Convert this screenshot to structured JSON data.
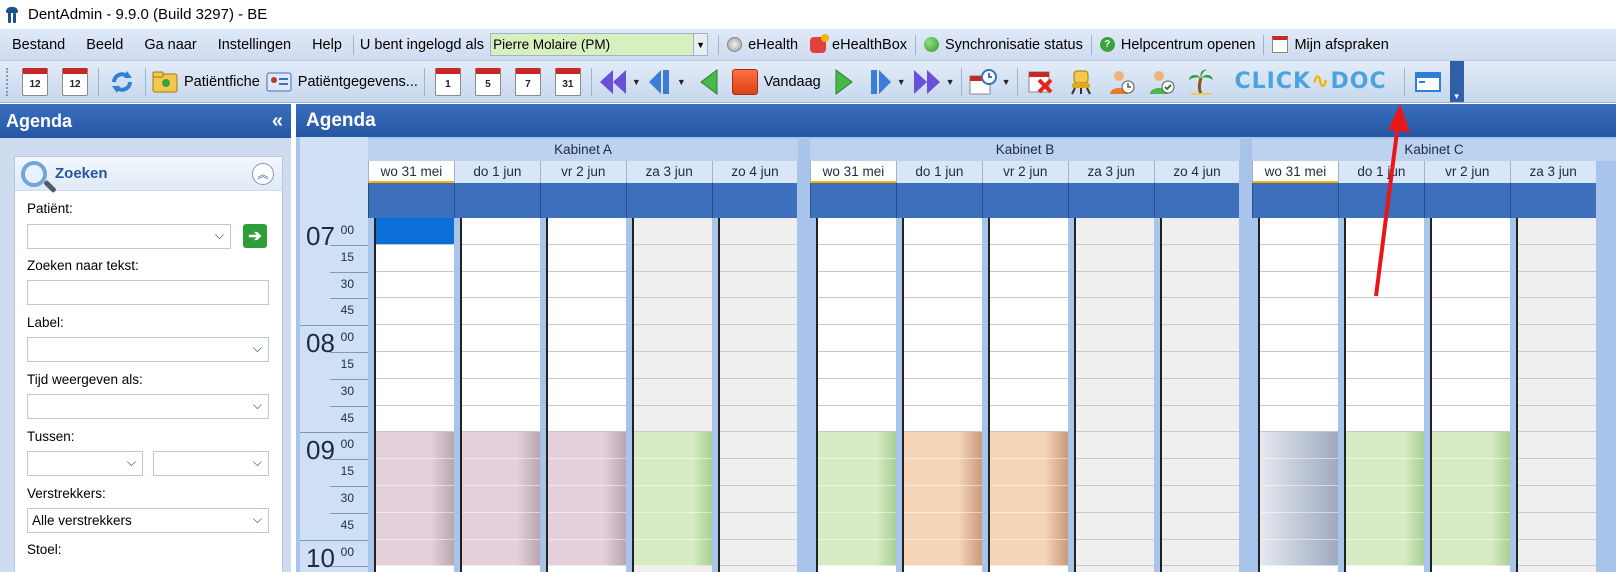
{
  "window": {
    "title": "DentAdmin - 9.9.0     (Build 3297) - BE"
  },
  "menu": {
    "items": [
      "Bestand",
      "Beeld",
      "Ga naar",
      "Instellingen",
      "Help"
    ],
    "logged_in_label": "U bent ingelogd als",
    "user": "Pierre Molaire (PM)",
    "ehealth": "eHealth",
    "ehealthbox": "eHealthBox",
    "sync": "Synchronisatie status",
    "help_center": "Helpcentrum openen",
    "my_appointments": "Mijn afspraken"
  },
  "toolbar": {
    "patientfiche": "Patiëntfiche",
    "patientgegevens": "Patiëntgegevens...",
    "cal_day": "1",
    "cal_5": "5",
    "cal_7": "7",
    "cal_31": "31",
    "vandaag": "Vandaag",
    "clickdoc_a": "CLICK",
    "clickdoc_b": "DOC",
    "clickdoc_wave": "∿"
  },
  "left_panel": {
    "title": "Agenda",
    "collapse": "«",
    "search_title": "Zoeken",
    "fields": {
      "patient": "Patiënt:",
      "text": "Zoeken naar tekst:",
      "label": "Label:",
      "time_display": "Tijd weergeven als:",
      "between": "Tussen:",
      "insurers": "Verstrekkers:",
      "insurers_value": "Alle verstrekkers",
      "chair": "Stoel:"
    }
  },
  "agenda": {
    "title": "Agenda",
    "hours": [
      {
        "h": "07",
        "m": [
          "00",
          "15",
          "30",
          "45"
        ]
      },
      {
        "h": "08",
        "m": [
          "00",
          "15",
          "30",
          "45"
        ]
      },
      {
        "h": "09",
        "m": [
          "00",
          "15",
          "30",
          "45"
        ]
      },
      {
        "h": "10",
        "m": [
          "00"
        ]
      }
    ],
    "cabinets": [
      {
        "name": "Kabinet A",
        "days": [
          "wo 31 mei",
          "do 1 jun",
          "vr 2 jun",
          "za 3 jun",
          "zo 4 jun"
        ]
      },
      {
        "name": "Kabinet B",
        "days": [
          "wo 31 mei",
          "do 1 jun",
          "vr 2 jun",
          "za 3 jun",
          "zo 4 jun"
        ]
      },
      {
        "name": "Kabinet C",
        "days": [
          "wo 31 mei",
          "do 1 jun",
          "vr 2 jun",
          "za 3 jun"
        ]
      }
    ]
  }
}
